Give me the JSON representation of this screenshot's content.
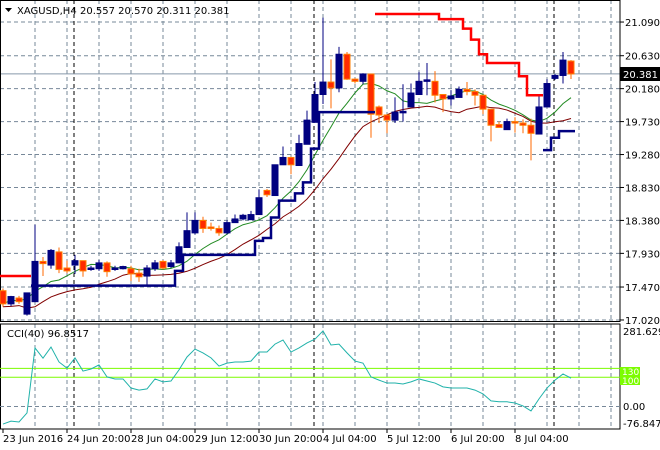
{
  "header": {
    "menu_icon": "triangle-down-icon",
    "symbol": "XAGUSD,H4",
    "ohlc": "20.557 20.570 20.311 20.381"
  },
  "indicator": {
    "label": "CCI(40) 96.8517",
    "max_label": "281.6292",
    "min_label": "-76.8473",
    "zero_label": "0.00",
    "level_high_label": "130",
    "level_low_label": "100"
  },
  "current_price_label": "20.381",
  "colors": {
    "bull": "#000080",
    "bear": "#ff2a00",
    "ma_fast": "#228b22",
    "ma_slow": "#800000",
    "trail_upper": "#ff0000",
    "trail_lower": "#000080",
    "cci": "#20b2aa",
    "cci_levels": "#7cfc00"
  },
  "chart_data": [
    {
      "type": "candlestick",
      "title": "XAGUSD,H4",
      "ylim": [
        17.006,
        21.391
      ],
      "y_ticks": [
        "21.090",
        "20.630",
        "20.180",
        "19.730",
        "19.280",
        "18.830",
        "18.380",
        "17.930",
        "17.470",
        "17.020"
      ],
      "current_price": 20.381,
      "x_labels": [
        {
          "index": 0,
          "label": "23 Jun 2016"
        },
        {
          "index": 8,
          "label": "24 Jun 20:00"
        },
        {
          "index": 16,
          "label": "28 Jun 04:00"
        },
        {
          "index": 24,
          "label": "29 Jun 12:00"
        },
        {
          "index": 32,
          "label": "30 Jun 20:00"
        },
        {
          "index": 40,
          "label": "4 Jul 04:00"
        },
        {
          "index": 48,
          "label": "5 Jul 12:00"
        },
        {
          "index": 56,
          "label": "6 Jul 20:00"
        },
        {
          "index": 64,
          "label": "8 Jul 04:00"
        }
      ],
      "separators": [
        9,
        39,
        69
      ],
      "candles_ohlc": [
        [
          17.42,
          17.45,
          17.2,
          17.24
        ],
        [
          17.24,
          17.35,
          17.21,
          17.34
        ],
        [
          17.32,
          17.35,
          17.24,
          17.27
        ],
        [
          17.1,
          17.39,
          17.08,
          17.39
        ],
        [
          17.27,
          18.32,
          17.27,
          17.82
        ],
        [
          17.82,
          17.88,
          17.62,
          17.79
        ],
        [
          17.77,
          17.99,
          17.72,
          17.97
        ],
        [
          17.95,
          18.01,
          17.66,
          17.71
        ],
        [
          17.73,
          17.83,
          17.66,
          17.69
        ],
        [
          17.77,
          17.91,
          17.65,
          17.83
        ],
        [
          17.83,
          17.83,
          17.61,
          17.69
        ],
        [
          17.71,
          17.76,
          17.69,
          17.73
        ],
        [
          17.72,
          17.84,
          17.69,
          17.8
        ],
        [
          17.8,
          17.82,
          17.61,
          17.68
        ],
        [
          17.71,
          17.76,
          17.69,
          17.73
        ],
        [
          17.72,
          17.76,
          17.71,
          17.75
        ],
        [
          17.72,
          17.76,
          17.55,
          17.65
        ],
        [
          17.66,
          17.72,
          17.54,
          17.61
        ],
        [
          17.62,
          17.77,
          17.49,
          17.73
        ],
        [
          17.72,
          17.84,
          17.69,
          17.8
        ],
        [
          17.82,
          17.84,
          17.71,
          17.73
        ],
        [
          17.75,
          17.84,
          17.73,
          17.8
        ],
        [
          17.8,
          18.08,
          17.8,
          18.02
        ],
        [
          18.01,
          18.49,
          18.01,
          18.24
        ],
        [
          18.21,
          18.49,
          18.19,
          18.38
        ],
        [
          18.38,
          18.43,
          18.21,
          18.27
        ],
        [
          18.29,
          18.35,
          18.24,
          18.27
        ],
        [
          18.27,
          18.31,
          18.17,
          18.21
        ],
        [
          18.21,
          18.38,
          18.19,
          18.35
        ],
        [
          18.35,
          18.46,
          18.35,
          18.4
        ],
        [
          18.4,
          18.47,
          18.38,
          18.45
        ],
        [
          18.39,
          18.51,
          18.39,
          18.46
        ],
        [
          18.46,
          18.8,
          18.46,
          18.69
        ],
        [
          18.79,
          18.81,
          18.7,
          18.73
        ],
        [
          18.72,
          19.14,
          18.72,
          19.14
        ],
        [
          19.14,
          19.39,
          19.14,
          19.24
        ],
        [
          19.24,
          19.25,
          19.01,
          19.14
        ],
        [
          19.13,
          19.55,
          19.13,
          19.43
        ],
        [
          19.42,
          19.88,
          19.42,
          19.75
        ],
        [
          19.72,
          20.27,
          19.72,
          20.1
        ],
        [
          20.1,
          21.15,
          19.97,
          20.27
        ],
        [
          20.27,
          20.58,
          19.91,
          20.19
        ],
        [
          20.19,
          20.75,
          20.13,
          20.65
        ],
        [
          20.65,
          20.68,
          20.3,
          20.31
        ],
        [
          20.31,
          20.32,
          20.25,
          20.28
        ],
        [
          20.28,
          20.39,
          20.24,
          20.38
        ],
        [
          20.38,
          20.38,
          19.51,
          19.83
        ],
        [
          19.93,
          19.95,
          19.71,
          19.82
        ],
        [
          19.82,
          19.83,
          19.57,
          19.75
        ],
        [
          19.75,
          20.06,
          19.71,
          19.86
        ],
        [
          19.86,
          20.24,
          19.73,
          19.87
        ],
        [
          19.93,
          20.25,
          19.93,
          20.12
        ],
        [
          20.1,
          20.41,
          20.1,
          20.28
        ],
        [
          20.28,
          20.53,
          20.09,
          20.3
        ],
        [
          20.28,
          20.42,
          19.99,
          20.09
        ],
        [
          20.1,
          20.1,
          19.86,
          20.04
        ],
        [
          20.04,
          20.16,
          19.95,
          20.08
        ],
        [
          20.06,
          20.21,
          20.06,
          20.17
        ],
        [
          20.17,
          20.27,
          20.09,
          20.14
        ],
        [
          20.14,
          20.17,
          19.95,
          20.09
        ],
        [
          20.09,
          20.09,
          19.83,
          19.9
        ],
        [
          19.9,
          19.9,
          19.46,
          19.68
        ],
        [
          19.69,
          19.73,
          19.65,
          19.65
        ],
        [
          19.62,
          19.77,
          19.62,
          19.73
        ],
        [
          19.73,
          19.79,
          19.58,
          19.71
        ],
        [
          19.71,
          19.76,
          19.57,
          19.68
        ],
        [
          19.68,
          19.77,
          19.2,
          19.57
        ],
        [
          19.56,
          20.08,
          19.56,
          19.93
        ],
        [
          19.93,
          20.31,
          19.93,
          20.25
        ],
        [
          20.32,
          20.38,
          20.3,
          20.36
        ],
        [
          20.36,
          20.68,
          20.25,
          20.57
        ],
        [
          20.557,
          20.57,
          20.311,
          20.381
        ]
      ],
      "trail_upper": [
        17.62,
        17.62,
        17.62,
        17.62,
        null,
        null,
        null,
        null,
        null,
        null,
        null,
        null,
        null,
        null,
        null,
        null,
        null,
        null,
        null,
        null,
        null,
        null,
        null,
        null,
        null,
        null,
        null,
        null,
        null,
        null,
        null,
        null,
        null,
        null,
        null,
        null,
        null,
        null,
        null,
        null,
        null,
        null,
        null,
        null,
        null,
        null,
        null,
        21.2,
        21.2,
        21.2,
        21.2,
        21.2,
        21.2,
        21.2,
        21.2,
        21.13,
        21.13,
        21.13,
        21.0,
        20.85,
        20.65,
        20.53,
        20.53,
        20.53,
        20.53,
        20.35,
        20.09,
        20.09,
        null,
        null,
        null,
        null
      ],
      "trail_lower": [
        null,
        null,
        null,
        null,
        17.49,
        17.49,
        17.49,
        17.49,
        17.49,
        17.49,
        17.49,
        17.49,
        17.49,
        17.49,
        17.49,
        17.49,
        17.49,
        17.49,
        17.49,
        17.49,
        17.49,
        17.49,
        17.69,
        17.91,
        17.91,
        17.91,
        17.91,
        17.91,
        17.91,
        17.91,
        17.91,
        17.91,
        18.1,
        18.14,
        18.42,
        18.65,
        18.65,
        18.75,
        18.9,
        19.36,
        19.86,
        19.86,
        19.86,
        19.86,
        19.86,
        19.86,
        19.86,
        null,
        null,
        null,
        null,
        null,
        null,
        null,
        null,
        null,
        null,
        null,
        null,
        null,
        null,
        null,
        null,
        null,
        null,
        null,
        null,
        null,
        19.34,
        19.51,
        19.6,
        19.6
      ]
    },
    {
      "type": "line",
      "title": "CCI(40)",
      "ylim": [
        -76.8473,
        281.6292
      ],
      "levels": [
        130,
        100,
        0
      ],
      "values": [
        -60,
        -50,
        -53,
        -22,
        200,
        165,
        203,
        152,
        131,
        166,
        121,
        128,
        142,
        101,
        94,
        94,
        63,
        56,
        60,
        94,
        84,
        87,
        125,
        169,
        196,
        183,
        166,
        138,
        148,
        152,
        152,
        155,
        186,
        186,
        213,
        227,
        186,
        200,
        217,
        230,
        258,
        210,
        213,
        183,
        155,
        148,
        101,
        90,
        80,
        80,
        77,
        84,
        94,
        87,
        80,
        67,
        63,
        63,
        63,
        56,
        43,
        19,
        16,
        16,
        12,
        2,
        -15,
        26,
        63,
        90,
        111,
        96.85
      ]
    }
  ]
}
